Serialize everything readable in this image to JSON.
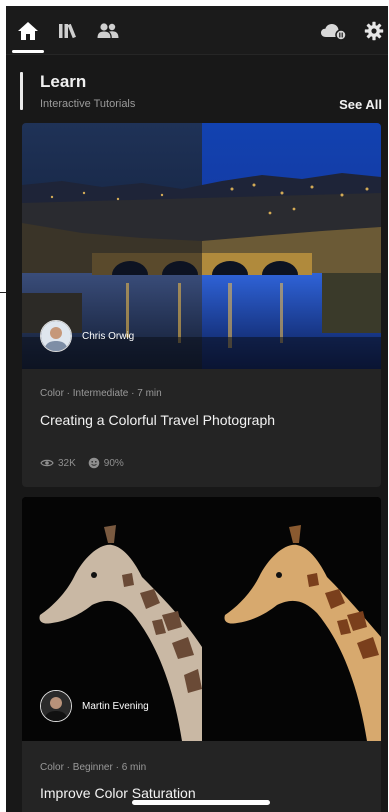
{
  "nav": {
    "icons": [
      "home-icon",
      "library-icon",
      "people-icon",
      "cloud-sync-icon",
      "gear-icon"
    ]
  },
  "learn": {
    "title": "Learn",
    "subtitle": "Interactive Tutorials",
    "see_all": "See All"
  },
  "tutorials": [
    {
      "author": "Chris Orwig",
      "meta": "Color · Intermediate · 7 min",
      "title": "Creating a Colorful Travel Photograph",
      "views": "32K",
      "rating": "90%"
    },
    {
      "author": "Martin Evening",
      "meta": "Color · Beginner · 6 min",
      "title": "Improve Color Saturation"
    }
  ],
  "colors": {
    "background": "#181818",
    "card": "#242424",
    "text": "#f3f3f3",
    "muted": "#9a9a9a"
  }
}
